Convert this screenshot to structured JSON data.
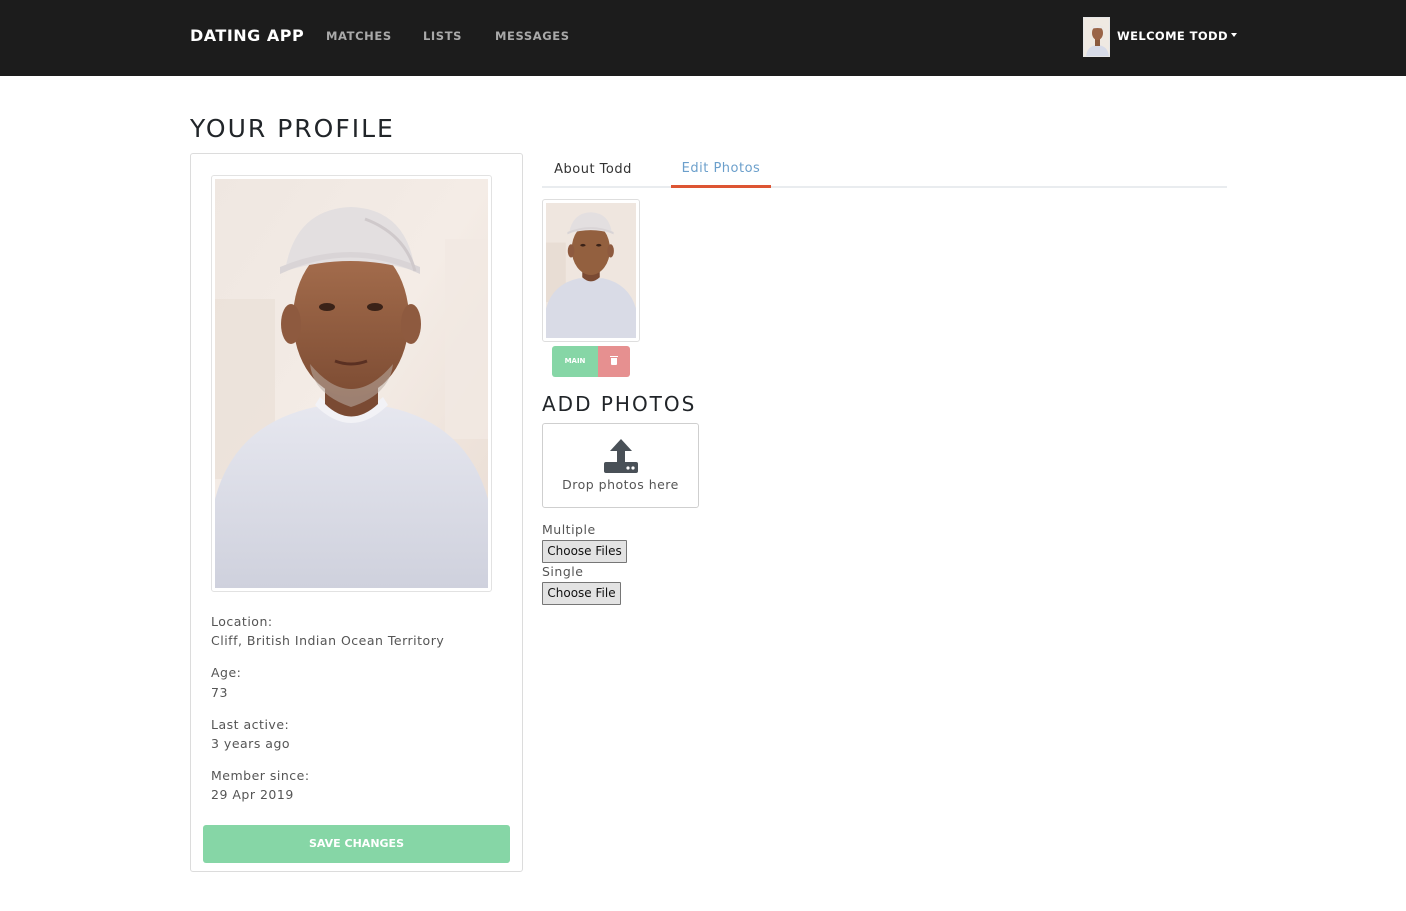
{
  "navbar": {
    "brand": "DATING APP",
    "links": [
      "MATCHES",
      "LISTS",
      "MESSAGES"
    ],
    "welcome": "WELCOME TODD"
  },
  "page": {
    "title": "YOUR PROFILE"
  },
  "profile": {
    "details": [
      {
        "label": "Location:",
        "value": "Cliff, British Indian Ocean Territory"
      },
      {
        "label": "Age:",
        "value": "73"
      },
      {
        "label": "Last active:",
        "value": "3 years ago"
      },
      {
        "label": "Member since:",
        "value": "29 Apr 2019"
      }
    ],
    "save_label": "SAVE CHANGES"
  },
  "tabs": [
    {
      "label": "About Todd",
      "active": false
    },
    {
      "label": "Edit Photos",
      "active": true
    }
  ],
  "photos": {
    "main_label": "MAIN",
    "delete_icon": "trash-icon"
  },
  "upload": {
    "title": "ADD PHOTOS",
    "drop_text": "Drop photos here",
    "upload_icon": "upload-icon",
    "multiple_label": "Multiple",
    "multiple_button": "Choose Files",
    "single_label": "Single",
    "single_button": "Choose File"
  },
  "colors": {
    "navbar_bg": "#1c1c1c",
    "success": "#86d6a6",
    "danger": "#e69090",
    "active_tab_text": "#6b9fcb",
    "active_tab_border": "#dd5533"
  }
}
